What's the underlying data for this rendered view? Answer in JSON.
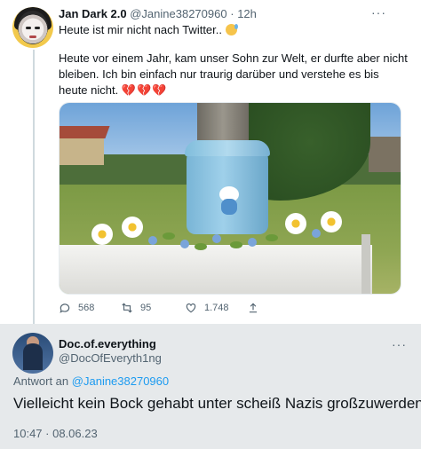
{
  "tweet": {
    "author_name": "Jan Dark 2.0",
    "handle": "@Janine38270960",
    "separator": "·",
    "time_ago": "12h",
    "more_label": "···",
    "line1": "Heute ist mir nicht nach Twitter..",
    "line2": "Heute vor einem Jahr, kam unser Sohn zur Welt, er durfte aber nicht bleiben. Ich bin einfach nur traurig darüber und verstehe es bis heute nicht.",
    "hearts": "💔💔💔",
    "actions": {
      "reply_count": "568",
      "retweet_count": "95",
      "like_count": "1.748"
    },
    "icons": [
      "sad-sweat-emoji",
      "broken-heart-emoji",
      "reply-icon",
      "retweet-icon",
      "like-icon",
      "share-icon"
    ]
  },
  "reply": {
    "author_name": "Doc.of.everything",
    "handle": "@DocOfEveryth1ng",
    "more_label": "···",
    "replying_to_label": "Antwort an",
    "replying_to_handle": "@Janine38270960",
    "text": "Vielleicht kein Bock gehabt unter scheiß Nazis großzuwerden.",
    "timestamp": "10:47 · 08.06.23"
  },
  "colors": {
    "accent": "#1d9bf0",
    "muted": "#536471",
    "text": "#0f1419",
    "reply_bg": "#e6e9eb"
  }
}
